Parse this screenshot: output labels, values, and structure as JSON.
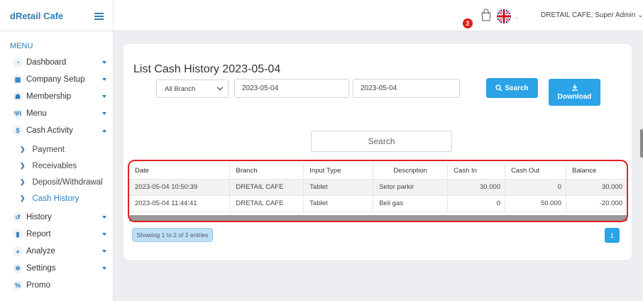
{
  "sidebar": {
    "brand": "dRetail Cafe",
    "menu_title": "MENU",
    "items": [
      {
        "label": "Dashboard",
        "icon": "dashboard-icon",
        "glyph": "◔"
      },
      {
        "label": "Company Setup",
        "icon": "building-icon",
        "glyph": "▦"
      },
      {
        "label": "Membership",
        "icon": "users-icon",
        "glyph": "☗"
      },
      {
        "label": "Menu",
        "icon": "utensils-icon",
        "glyph": "ΨΙ"
      },
      {
        "label": "Cash Activity",
        "icon": "dollar-icon",
        "glyph": "$"
      }
    ],
    "sub_items": [
      "Payment",
      "Receivables",
      "Deposit/Withdrawal",
      "Cash History"
    ],
    "items_bottom": [
      {
        "label": "History",
        "icon": "history-icon",
        "glyph": "↺"
      },
      {
        "label": "Report",
        "icon": "file-icon",
        "glyph": "▮"
      },
      {
        "label": "Analyze",
        "icon": "pie-chart-icon",
        "glyph": "◕"
      },
      {
        "label": "Settings",
        "icon": "gear-icon",
        "glyph": "✲"
      },
      {
        "label": "Promo",
        "icon": "percent-icon",
        "glyph": "%"
      }
    ]
  },
  "topbar": {
    "cart_count": "2",
    "user": "DRETAIL CAFE, Super Admin ⌄"
  },
  "main": {
    "title": "List Cash History 2023-05-04",
    "branch_select": "All Branch",
    "date_from": "2023-05-04",
    "date_to": "2023-05-04",
    "search_button": "Search",
    "download_button": "Download",
    "search_placeholder": "Search",
    "table": {
      "headers": [
        "Date",
        "Branch",
        "Input Type",
        "Description",
        "Cash In",
        "Cash Out",
        "Balance"
      ],
      "rows": [
        [
          "2023-05-04 10:50:39",
          "DRETAIL CAFE",
          "Tablet",
          "Setor parkir",
          "30.000",
          "0",
          "30.000"
        ],
        [
          "2023-05-04 11:44:41",
          "DRETAIL CAFE",
          "Tablet",
          "Beli gas",
          "0",
          "50.000",
          "-20.000"
        ]
      ]
    },
    "entries_info": "Showing 1 to 2 of 2 entries",
    "current_page": "1"
  },
  "colors": {
    "accent": "#2ba3e6",
    "brand": "#2f7db8",
    "badge": "#e21b1b",
    "highlight": "#e22020"
  }
}
